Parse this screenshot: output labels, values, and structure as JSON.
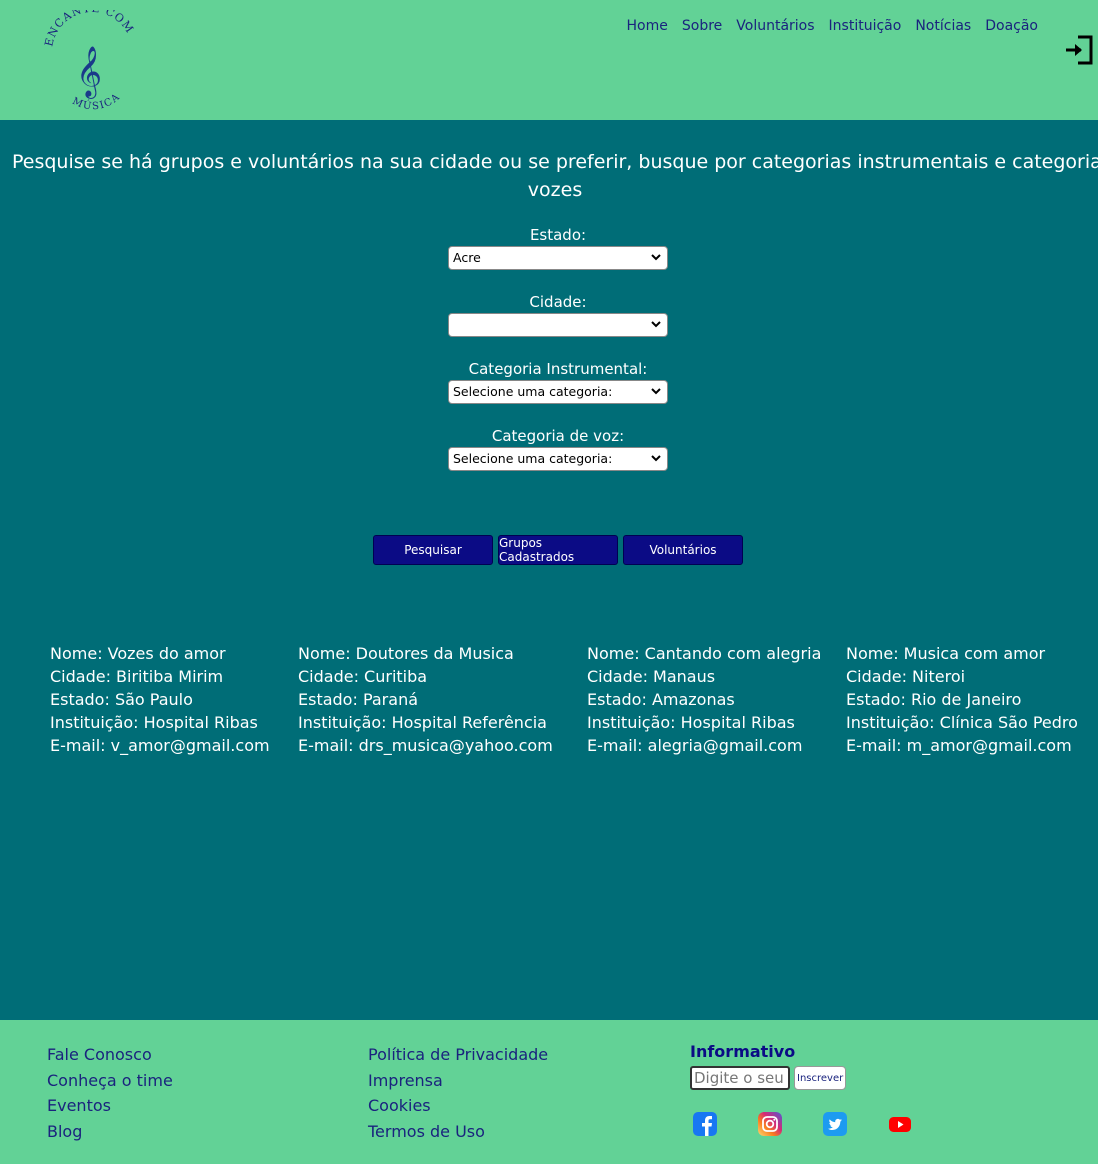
{
  "header": {
    "logo_alt": "Encante com Música",
    "nav": [
      "Home",
      "Sobre",
      "Voluntários",
      "Instituição",
      "Notícias",
      "Doação"
    ]
  },
  "main": {
    "headline_line1": "Pesquise se há grupos e voluntários na sua cidade ou se preferir, busque por categorias instrumentais e categorias de",
    "headline_line2": "vozes",
    "estado_label": "Estado:",
    "estado_value": "Acre",
    "cidade_label": "Cidade:",
    "cidade_value": "",
    "instrumental_label": "Categoria Instrumental:",
    "instrumental_value": "Selecione uma categoria:",
    "voz_label": "Categoria de voz:",
    "voz_value": "Selecione uma categoria:",
    "btn_search": "Pesquisar",
    "btn_groups": "Grupos Cadastrados",
    "btn_volunteers": "Voluntários"
  },
  "results": [
    {
      "nome": "Nome: Vozes do amor",
      "cidade": "Cidade: Biritiba Mirim",
      "estado": "Estado: São Paulo",
      "instituicao": "Instituição: Hospital Ribas",
      "email": "E-mail: v_amor@gmail.com"
    },
    {
      "nome": "Nome: Doutores da Musica",
      "cidade": "Cidade: Curitiba",
      "estado": "Estado: Paraná",
      "instituicao": "Instituição: Hospital Referência",
      "email": "E-mail: drs_musica@yahoo.com"
    },
    {
      "nome": "Nome: Cantando com alegria",
      "cidade": "Cidade: Manaus",
      "estado": "Estado: Amazonas",
      "instituicao": "Instituição: Hospital Ribas",
      "email": "E-mail: alegria@gmail.com"
    },
    {
      "nome": "Nome: Musica com amor",
      "cidade": "Cidade: Niteroi",
      "estado": "Estado: Rio de Janeiro",
      "instituicao": "Instituição: Clínica São Pedro",
      "email": "E-mail: m_amor@gmail.com"
    }
  ],
  "footer": {
    "col1": [
      "Fale Conosco",
      "Conheça o time",
      "Eventos",
      "Blog"
    ],
    "col2": [
      "Política de Privacidade",
      "Imprensa",
      "Cookies",
      "Termos de Uso"
    ],
    "newsletter_title": "Informativo",
    "newsletter_placeholder": "Digite o seu e-mail",
    "newsletter_button": "Inscrever"
  },
  "colors": {
    "header_bg": "#62d296",
    "main_bg": "#006d77",
    "button_bg": "#0b0b85",
    "nav_text": "#1a237e"
  },
  "icons": [
    "treble-clef-logo",
    "login-icon",
    "facebook-icon",
    "instagram-icon",
    "twitter-icon",
    "youtube-icon"
  ]
}
